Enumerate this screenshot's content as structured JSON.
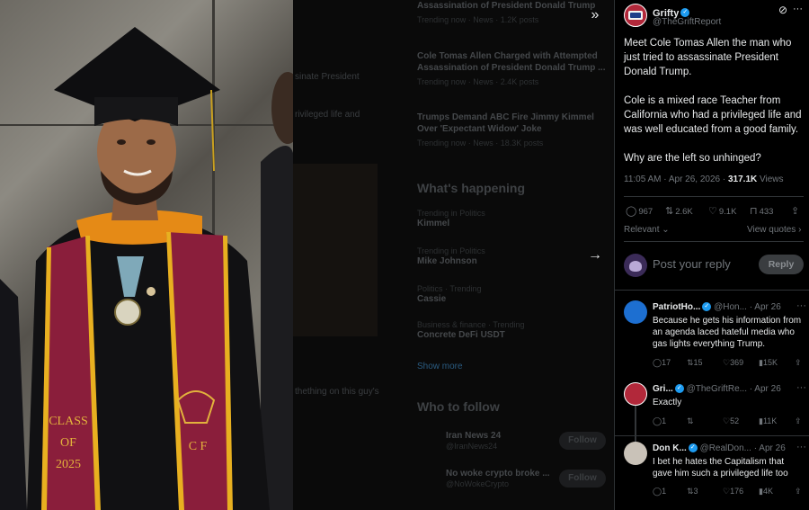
{
  "background": {
    "trends_top": [
      {
        "title": "Assassination of President Donald Trump",
        "meta": "Trending now · News · 1.2K posts"
      },
      {
        "title": "Cole Tomas Allen Charged with Attempted Assassination of President Donald Trump ...",
        "meta": "Trending now · News · 2.4K posts"
      },
      {
        "title": "Trumps Demand ABC Fire Jimmy Kimmel Over 'Expectant Widow' Joke",
        "meta": "Trending now · News · 18.3K posts"
      }
    ],
    "whats_happening": "What's happening",
    "trends": [
      {
        "meta": "Trending in Politics",
        "title": "Kimmel"
      },
      {
        "meta": "Trending in Politics",
        "title": "Mike Johnson"
      },
      {
        "meta": "Politics · Trending",
        "title": "Cassie"
      },
      {
        "meta": "Business & finance · Trending",
        "title": "Concrete DeFi USDT"
      }
    ],
    "show_more": "Show more",
    "who_to_follow": "Who to follow",
    "follow_suggestions": [
      {
        "name": "Iran News 24",
        "handle": "@IranNews24"
      },
      {
        "name": "No woke crypto broke ...",
        "handle": "@NoWokeCrypto"
      }
    ],
    "follow_label": "Follow",
    "timeline_fragments": [
      "sinate President",
      "rivileged life and",
      "thething on this guy's"
    ]
  },
  "media": {
    "photo_caption_text": [
      "CLASS",
      "OF",
      "2025"
    ],
    "stole_letters": "C F"
  },
  "post": {
    "author_name": "Grifty",
    "author_handle": "@TheGriftReport",
    "paragraphs": [
      "Meet Cole Tomas Allen the man who just tried to assassinate President Donald Trump.",
      "Cole is a mixed race Teacher from California who had a privileged life and was well educated from a good family.",
      "Why are the left so unhinged?"
    ],
    "time": "11:05 AM · Apr 26, 2026 ·",
    "views_count": "317.1K",
    "views_label": "Views",
    "replies": "967",
    "reposts": "2.6K",
    "likes": "9.1K",
    "bookmarks": "433",
    "sort_label": "Relevant",
    "view_quotes": "View quotes"
  },
  "reply_box": {
    "placeholder": "Post your reply",
    "button": "Reply"
  },
  "replies": [
    {
      "name": "PatriotHo...",
      "handle": "@Hon...",
      "date": "· Apr 26",
      "text": "Because he gets his information from an agenda laced hateful media who gas lights everything Trump.",
      "replies": "17",
      "reposts": "15",
      "likes": "369",
      "views": "15K",
      "avatar_color": "#1d6fd1"
    },
    {
      "name": "Gri...",
      "handle": "@TheGriftRe...",
      "date": "· Apr 26",
      "text": "Exactly",
      "replies": "1",
      "reposts": "",
      "likes": "52",
      "views": "11K",
      "avatar_color": "#b2283a"
    },
    {
      "name": "Don K...",
      "handle": "@RealDon...",
      "date": "· Apr 26",
      "text": "I bet he hates the Capitalism that gave him such a privileged life too",
      "replies": "1",
      "reposts": "3",
      "likes": "176",
      "views": "4K",
      "avatar_color": "#c9c2b8"
    }
  ],
  "icons": {
    "expand": "»",
    "next": "→",
    "more": "···",
    "grok": "⊘"
  },
  "colors": {
    "accent": "#1d9bf0",
    "text": "#e7e9ea",
    "muted": "#71767b",
    "border": "#2f3336"
  }
}
